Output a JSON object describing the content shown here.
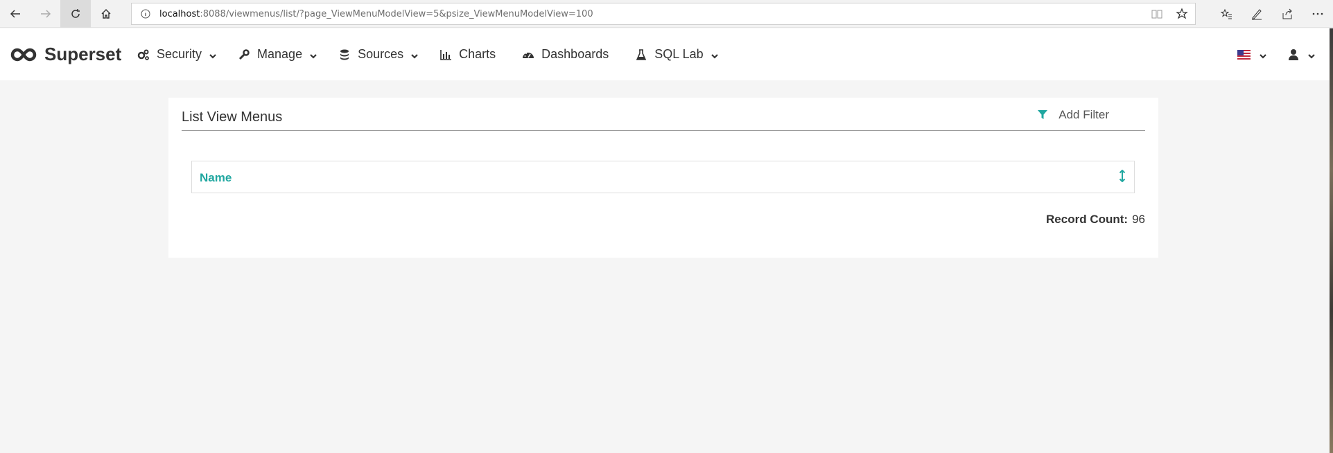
{
  "browser": {
    "url_host": "localhost",
    "url_path": ":8088/viewmenus/list/?page_ViewMenuModelView=5&psize_ViewMenuModelView=100"
  },
  "app": {
    "brand": "Superset",
    "menu": [
      {
        "label": "Security",
        "icon": "gears-icon",
        "dropdown": true
      },
      {
        "label": "Manage",
        "icon": "wrench-icon",
        "dropdown": true
      },
      {
        "label": "Sources",
        "icon": "database-icon",
        "dropdown": true
      },
      {
        "label": "Charts",
        "icon": "bar-chart-icon",
        "dropdown": false
      },
      {
        "label": "Dashboards",
        "icon": "dashboard-icon",
        "dropdown": false
      },
      {
        "label": "SQL Lab",
        "icon": "flask-icon",
        "dropdown": true
      }
    ],
    "language_icon": "us-flag-icon",
    "user_icon": "user-icon"
  },
  "panel": {
    "title": "List View Menus",
    "add_filter": "Add Filter",
    "column_header": "Name",
    "record_count_label": "Record Count:",
    "record_count": "96"
  },
  "colors": {
    "accent": "#20a7a0",
    "background": "#f5f5f5"
  }
}
